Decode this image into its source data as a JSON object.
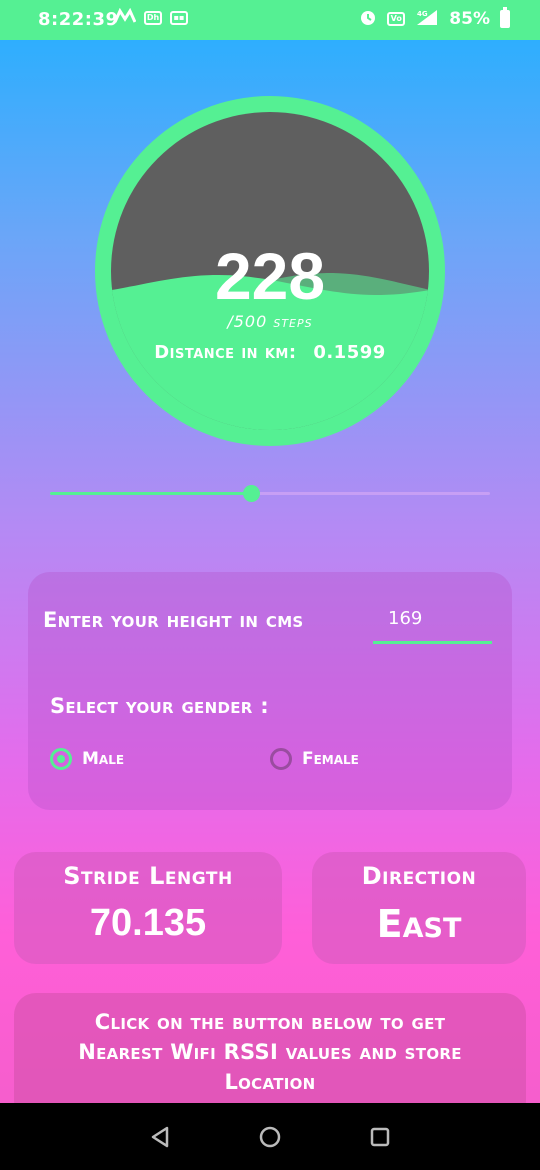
{
  "status_bar": {
    "time": "8:22:39",
    "battery": "85%",
    "network": "4G"
  },
  "gauge": {
    "steps": "228",
    "goal_label": "/500 steps",
    "progress": 0.456,
    "distance_label": "Distance in km:",
    "distance_value": "0.1599"
  },
  "slider": {
    "value": 0.456
  },
  "profile": {
    "height_label": "Enter your height in cms",
    "height_value": "169",
    "gender_label": "Select your gender :",
    "gender_options": [
      "Male",
      "Female"
    ],
    "selected_gender": "Male"
  },
  "stride_card": {
    "title": "Stride Length",
    "value": "70.135"
  },
  "direction_card": {
    "title": "Direction",
    "value": "East"
  },
  "wifi_card": {
    "text": "Click on the button below to get Nearest Wifi RSSI values and store Location"
  },
  "colors": {
    "accent": "#55f093",
    "gauge_empty": "#5f5f5f"
  }
}
